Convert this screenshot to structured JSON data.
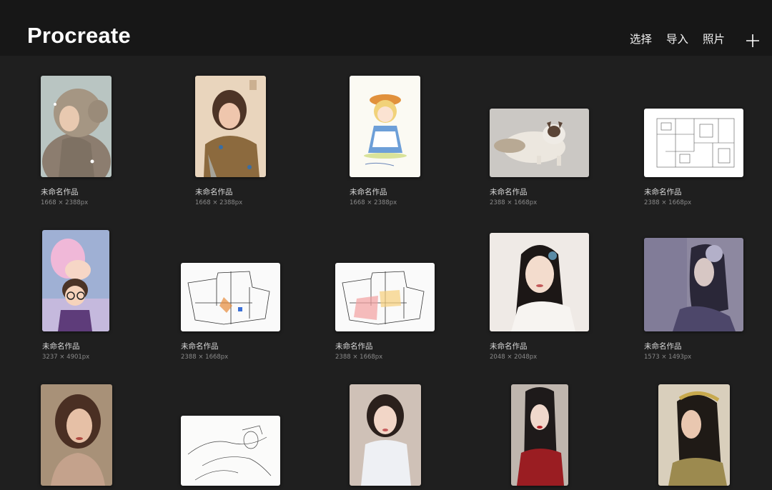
{
  "header": {
    "app_title": "Procreate",
    "actions": {
      "select": "选择",
      "import": "导入",
      "photos": "照片"
    },
    "add_icon": "plus-icon"
  },
  "gallery": {
    "items": [
      {
        "title": "未命名作品",
        "size": "1668 × 2388px",
        "subject": "girl in fur hood"
      },
      {
        "title": "未命名作品",
        "size": "1668 × 2388px",
        "subject": "girl with scarf"
      },
      {
        "title": "未命名作品",
        "size": "1668 × 2388px",
        "subject": "blonde girl with hat"
      },
      {
        "title": "未命名作品",
        "size": "2388 × 1668px",
        "subject": "ragdoll cat"
      },
      {
        "title": "未命名作品",
        "size": "2388 × 1668px",
        "subject": "floor plan"
      },
      {
        "title": "未命名作品",
        "size": "3237 × 4901px",
        "subject": "cartoon couple"
      },
      {
        "title": "未命名作品",
        "size": "2388 × 1668px",
        "subject": "floor plan sketch"
      },
      {
        "title": "未命名作品",
        "size": "2388 × 1668px",
        "subject": "floor plan colored"
      },
      {
        "title": "未命名作品",
        "size": "2048 × 2048px",
        "subject": "portrait with flower"
      },
      {
        "title": "未命名作品",
        "size": "1573 × 1493px",
        "subject": "purple portrait"
      },
      {
        "title": "",
        "size": "",
        "subject": "painted portrait"
      },
      {
        "title": "",
        "size": "",
        "subject": "pencil sketch"
      },
      {
        "title": "",
        "size": "",
        "subject": "girl in white dress"
      },
      {
        "title": "",
        "size": "",
        "subject": "girl in red"
      },
      {
        "title": "",
        "size": "",
        "subject": "girl with headband"
      }
    ]
  }
}
